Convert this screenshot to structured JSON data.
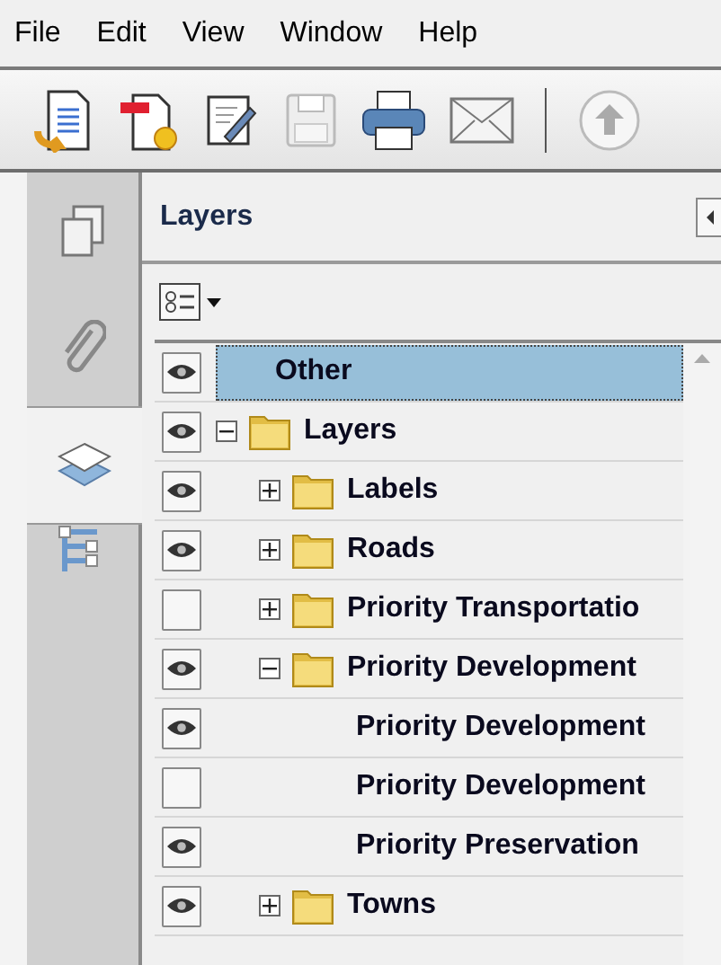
{
  "menu": [
    "File",
    "Edit",
    "View",
    "Window",
    "Help"
  ],
  "panel": {
    "title": "Layers"
  },
  "layers": [
    {
      "name": "Other",
      "kind": "layer",
      "visible": true,
      "selected": true
    },
    {
      "name": "Layers",
      "kind": "folder",
      "visible": true,
      "selected": false,
      "expanded": true,
      "children": [
        {
          "name": "Labels",
          "kind": "folder",
          "visible": true,
          "selected": false,
          "expanded": false
        },
        {
          "name": "Roads",
          "kind": "folder",
          "visible": true,
          "selected": false,
          "expanded": false
        },
        {
          "name": "Priority Transportatio",
          "kind": "folder",
          "visible": false,
          "selected": false,
          "expanded": false
        },
        {
          "name": "Priority Development",
          "kind": "folder",
          "visible": true,
          "selected": false,
          "expanded": true,
          "children": [
            {
              "name": "Priority Development",
              "kind": "layer",
              "visible": true,
              "selected": false
            },
            {
              "name": "Priority Development",
              "kind": "layer",
              "visible": false,
              "selected": false
            },
            {
              "name": "Priority Preservation",
              "kind": "layer",
              "visible": true,
              "selected": false
            }
          ]
        },
        {
          "name": "Towns",
          "kind": "folder",
          "visible": true,
          "selected": false,
          "expanded": false
        }
      ]
    }
  ]
}
